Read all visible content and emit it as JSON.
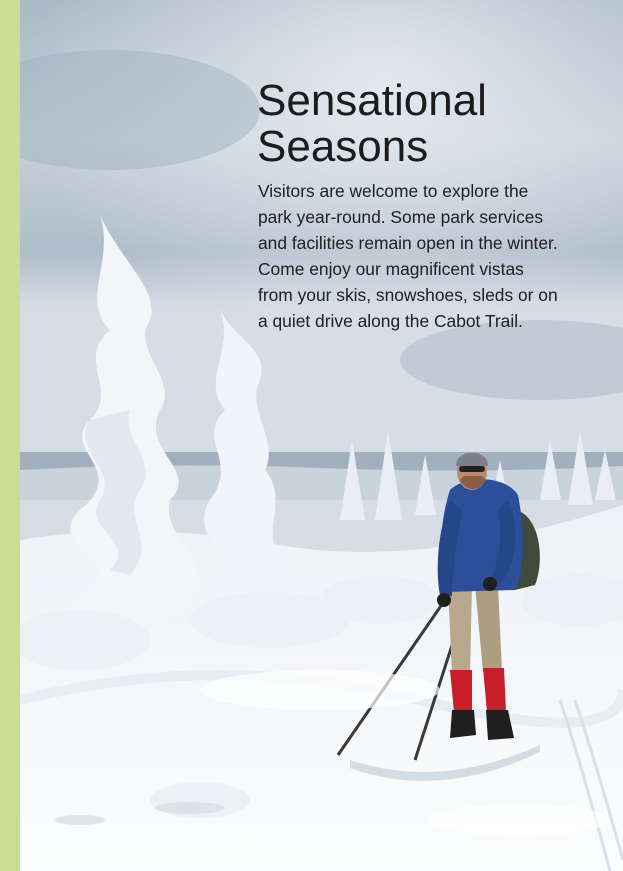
{
  "article": {
    "title_line1": "Sensational",
    "title_line2": "Seasons",
    "body": "Visitors are welcome to explore the park year-round. Some park services and facilities remain open in the winter. Come enjoy our magnificent vistas from your skis, snowshoes, sleds or on a quiet drive along the Cabot Trail."
  },
  "colors": {
    "side_bar": "#c9de93",
    "sky": "#b7c4d3",
    "snow": "#f4f7fa",
    "jacket": "#2d4f99",
    "gaiters": "#c81e2a"
  }
}
